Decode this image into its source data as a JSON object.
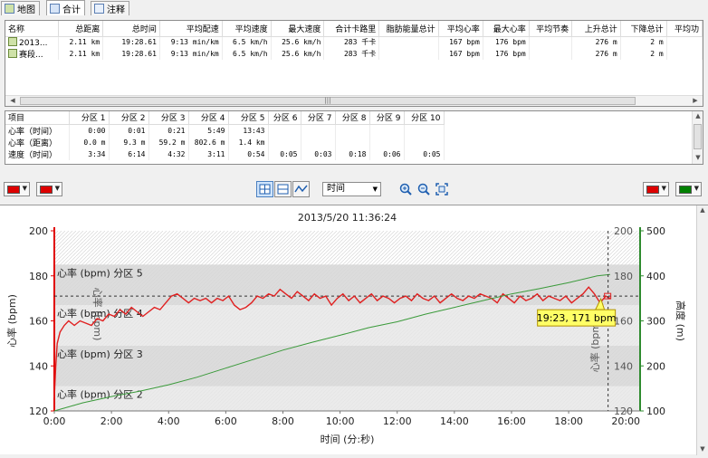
{
  "tabs": [
    {
      "label": "地图",
      "icon": "map-icon"
    },
    {
      "label": "合计",
      "icon": "table-icon"
    },
    {
      "label": "注释",
      "icon": "notes-icon"
    }
  ],
  "summary_table": {
    "columns": [
      "名称",
      "总距离",
      "总时间",
      "平均配速",
      "平均速度",
      "最大速度",
      "合计卡路里",
      "脂肪能量总计",
      "平均心率",
      "最大心率",
      "平均节奏",
      "上升总计",
      "下降总计",
      "平均功"
    ],
    "rows": [
      [
        "2013...",
        "2.11 km",
        "19:28.61",
        "9:13 min/km",
        "6.5 km/h",
        "25.6 km/h",
        "283 千卡",
        "",
        "167 bpm",
        "176 bpm",
        "",
        "276 m",
        "2 m",
        ""
      ],
      [
        "赛段...",
        "2.11 km",
        "19:28.61",
        "9:13 min/km",
        "6.5 km/h",
        "25.6 km/h",
        "283 千卡",
        "",
        "167 bpm",
        "176 bpm",
        "",
        "276 m",
        "2 m",
        ""
      ]
    ]
  },
  "zone_table": {
    "columns": [
      "项目",
      "分区 1",
      "分区 2",
      "分区 3",
      "分区 4",
      "分区 5",
      "分区 6",
      "分区 7",
      "分区 8",
      "分区 9",
      "分区 10"
    ],
    "rows": [
      [
        "心率（时间）",
        "0:00",
        "0:01",
        "0:21",
        "5:49",
        "13:43",
        "",
        "",
        "",
        "",
        ""
      ],
      [
        "心率（距离）",
        "0.0 m",
        "9.3 m",
        "59.2 m",
        "802.6 m",
        "1.4 km",
        "",
        "",
        "",
        "",
        ""
      ],
      [
        "速度（时间）",
        "3:34",
        "6:14",
        "4:32",
        "3:11",
        "0:54",
        "0:05",
        "0:03",
        "0:18",
        "0:06",
        "0:05"
      ]
    ]
  },
  "toolbar": {
    "left_color1": "#dd0000",
    "left_color2": "#dd0000",
    "right_color1": "#dd0000",
    "right_color2": "#008000",
    "x_axis_select": "时间"
  },
  "chart_data": {
    "type": "line",
    "title": "2013/5/20 11:36:24",
    "xlabel": "时间 (分:秒)",
    "ylabel_left": "心率 (bpm)",
    "ylabel_right": "高度 (m)",
    "xlim": [
      0,
      20.5
    ],
    "ylim_left": [
      120,
      200
    ],
    "ylim_right": [
      100,
      500
    ],
    "x_ticks": [
      "0:00",
      "2:00",
      "4:00",
      "6:00",
      "8:00",
      "10:00",
      "12:00",
      "14:00",
      "16:00",
      "18:00",
      "20:00"
    ],
    "y_ticks_left": [
      120,
      140,
      160,
      180,
      200
    ],
    "y_ticks_right": [
      100,
      200,
      300,
      400,
      500
    ],
    "zones": [
      {
        "label": "心率 (bpm) 分区 2",
        "from": 120,
        "to": 131,
        "color": "#e8e8e8"
      },
      {
        "label": "心率 (bpm) 分区 3",
        "from": 131,
        "to": 149,
        "color": "#d6d6d6"
      },
      {
        "label": "心率 (bpm) 分区 4",
        "from": 149,
        "to": 167,
        "color": "#e8e8e8"
      },
      {
        "label": "心率 (bpm) 分区 5",
        "from": 167,
        "to": 185,
        "color": "#d6d6d6"
      }
    ],
    "avg_hr": 171,
    "cursor_x": 19.38,
    "tooltip": "19:23, 171 bpm",
    "series": [
      {
        "color": "#e02020",
        "axis": "left",
        "x": [
          0,
          0.05,
          0.1,
          0.2,
          0.35,
          0.5,
          0.7,
          0.9,
          1.1,
          1.3,
          1.5,
          1.7,
          1.9,
          2.1,
          2.3,
          2.5,
          2.7,
          2.9,
          3.1,
          3.3,
          3.5,
          3.7,
          3.9,
          4.1,
          4.3,
          4.5,
          4.7,
          4.9,
          5.1,
          5.3,
          5.5,
          5.7,
          5.9,
          6.1,
          6.3,
          6.5,
          6.7,
          6.9,
          7.1,
          7.3,
          7.5,
          7.7,
          7.9,
          8.1,
          8.3,
          8.5,
          8.7,
          8.9,
          9.1,
          9.3,
          9.5,
          9.7,
          9.9,
          10.1,
          10.3,
          10.5,
          10.7,
          10.9,
          11.1,
          11.3,
          11.5,
          11.7,
          11.9,
          12.1,
          12.3,
          12.5,
          12.7,
          12.9,
          13.1,
          13.3,
          13.5,
          13.7,
          13.9,
          14.1,
          14.3,
          14.5,
          14.7,
          14.9,
          15.1,
          15.3,
          15.5,
          15.7,
          15.9,
          16.1,
          16.3,
          16.5,
          16.7,
          16.9,
          17.1,
          17.3,
          17.5,
          17.7,
          17.9,
          18.1,
          18.3,
          18.5,
          18.7,
          18.9,
          19.1,
          19.3,
          19.45
        ],
        "y": [
          126,
          140,
          150,
          155,
          158,
          160,
          158,
          160,
          159,
          158,
          161,
          160,
          163,
          162,
          165,
          163,
          166,
          164,
          162,
          164,
          166,
          165,
          168,
          171,
          172,
          170,
          168,
          170,
          169,
          170,
          168,
          170,
          169,
          171,
          167,
          165,
          166,
          168,
          171,
          170,
          172,
          171,
          174,
          172,
          170,
          173,
          171,
          169,
          172,
          170,
          171,
          167,
          170,
          172,
          169,
          171,
          168,
          170,
          172,
          169,
          171,
          170,
          168,
          170,
          171,
          169,
          172,
          170,
          169,
          171,
          168,
          170,
          172,
          170,
          169,
          171,
          170,
          172,
          171,
          170,
          168,
          172,
          170,
          168,
          171,
          169,
          170,
          172,
          169,
          171,
          170,
          169,
          171,
          168,
          170,
          172,
          175,
          172,
          168,
          171,
          170
        ]
      },
      {
        "color": "#3a9a3a",
        "axis": "right",
        "x": [
          0,
          1,
          2,
          3,
          4,
          5,
          6,
          7,
          8,
          9,
          10,
          11,
          12,
          13,
          14,
          15,
          16,
          17,
          18,
          19,
          19.45
        ],
        "y": [
          100,
          118,
          132,
          144,
          158,
          175,
          195,
          215,
          235,
          252,
          268,
          285,
          298,
          315,
          330,
          345,
          360,
          372,
          385,
          400,
          403
        ]
      }
    ]
  }
}
